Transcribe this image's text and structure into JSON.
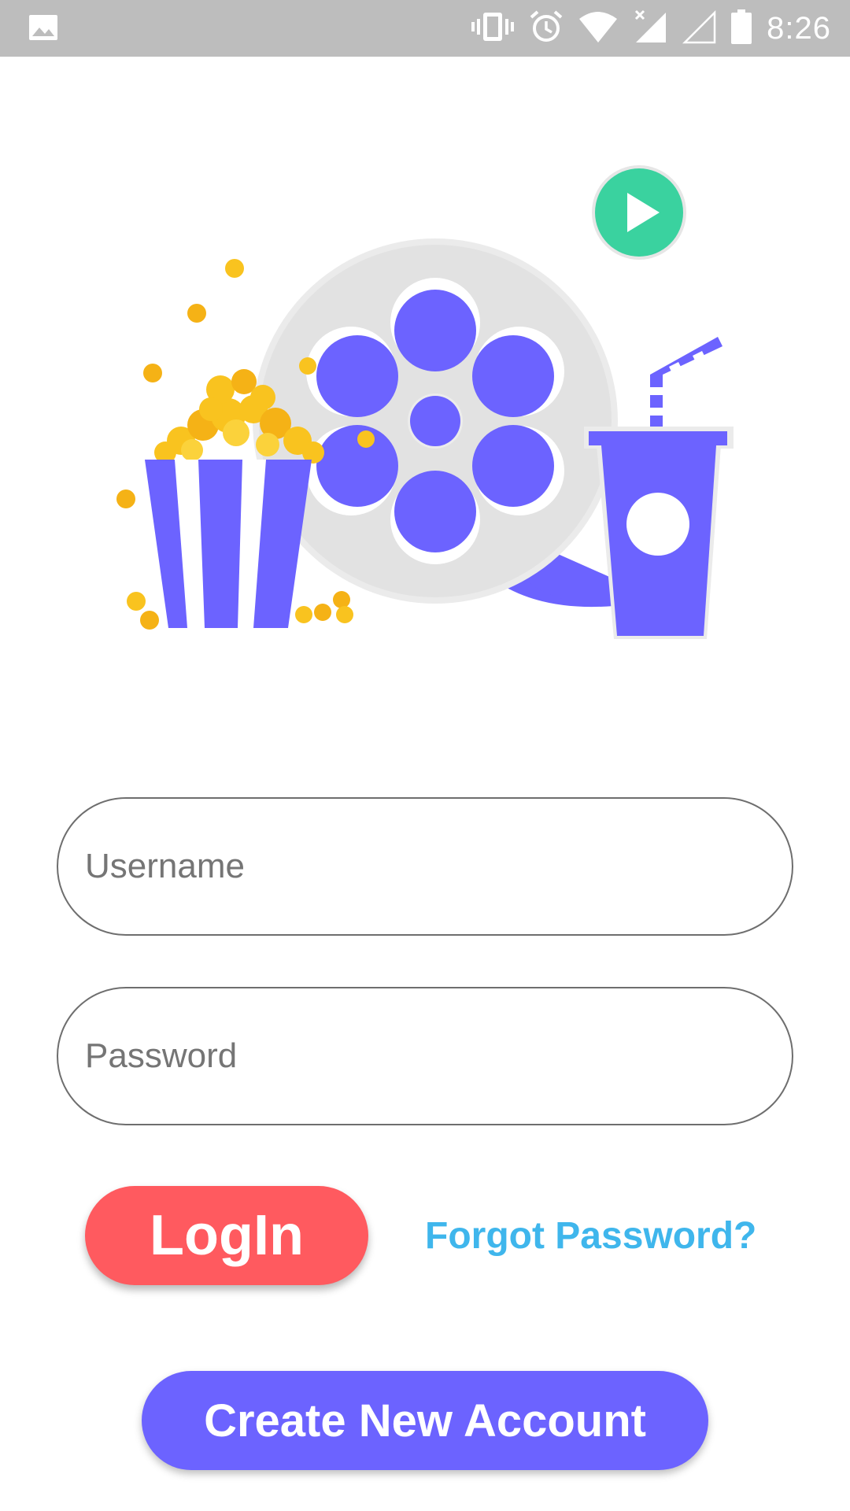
{
  "status_bar": {
    "time": "8:26",
    "icons": [
      "image-notification-icon",
      "vibrate-icon",
      "alarm-icon",
      "wifi-icon",
      "signal-icon",
      "signal-empty-icon",
      "battery-icon"
    ]
  },
  "illustration": {
    "name": "movie-reel-popcorn-drink-illustration",
    "colors": {
      "primary": "#6c63ff",
      "reel": "#e6e6e6",
      "popcorn": "#f9c31f",
      "play": "#3ad29f"
    }
  },
  "form": {
    "username_placeholder": "Username",
    "password_placeholder": "Password"
  },
  "actions": {
    "login_label": "LogIn",
    "forgot_label": "Forgot Password?",
    "create_label": "Create New Account"
  },
  "colors": {
    "login_bg": "#ff5a5f",
    "forgot_text": "#3fb6ec",
    "create_bg": "#6c63ff",
    "status_bar_bg": "#bdbdbd"
  }
}
